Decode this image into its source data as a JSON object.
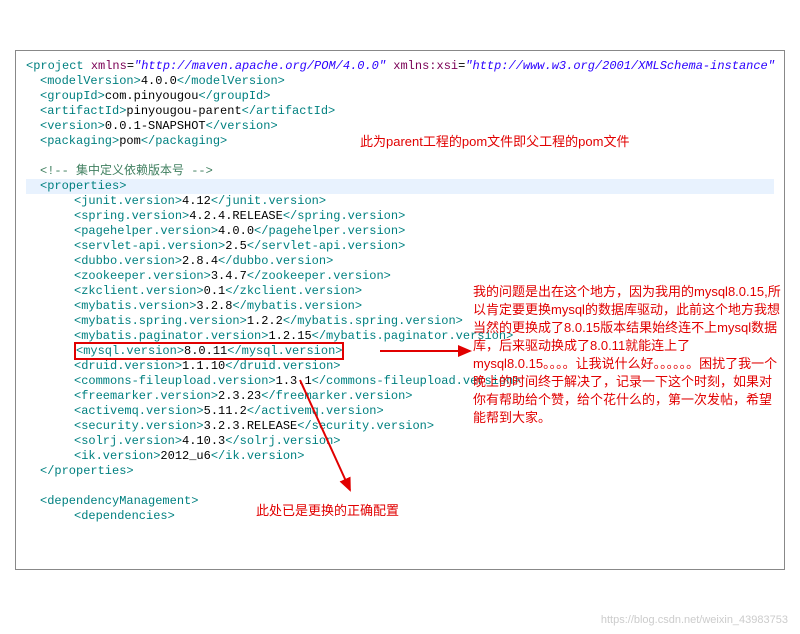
{
  "pom": {
    "project_open": "<project",
    "xmlns_attr": "xmlns",
    "xmlns_val": "\"http://maven.apache.org/POM/4.0.0\"",
    "xsi_attr": "xmlns:xsi",
    "xsi_val": "\"http://www.w3.org/2001/XMLSchema-instance\"",
    "modelVersion": "4.0.0",
    "groupId": "com.pinyougou",
    "artifactId": "pinyougou-parent",
    "version": "0.0.1-SNAPSHOT",
    "packaging": "pom",
    "comment_props": "<!-- 集中定义依赖版本号 -->",
    "props_open": "<properties>",
    "props_close": "</properties>",
    "deps_mgmt": "<dependencyManagement>",
    "deps_open": "<dependencies>",
    "props": [
      {
        "key": "junit.version",
        "val": "4.12"
      },
      {
        "key": "spring.version",
        "val": "4.2.4.RELEASE"
      },
      {
        "key": "pagehelper.version",
        "val": "4.0.0"
      },
      {
        "key": "servlet-api.version",
        "val": "2.5"
      },
      {
        "key": "dubbo.version",
        "val": "2.8.4"
      },
      {
        "key": "zookeeper.version",
        "val": "3.4.7"
      },
      {
        "key": "zkclient.version",
        "val": "0.1"
      },
      {
        "key": "mybatis.version",
        "val": "3.2.8"
      },
      {
        "key": "mybatis.spring.version",
        "val": "1.2.2"
      },
      {
        "key": "mybatis.paginator.version",
        "val": "1.2.15"
      },
      {
        "key": "mysql.version",
        "val": "8.0.11"
      },
      {
        "key": "druid.version",
        "val": "1.1.10"
      },
      {
        "key": "commons-fileupload.version",
        "val": "1.3.1"
      },
      {
        "key": "freemarker.version",
        "val": "2.3.23"
      },
      {
        "key": "activemq.version",
        "val": "5.11.2"
      },
      {
        "key": "security.version",
        "val": "3.2.3.RELEASE"
      },
      {
        "key": "solrj.version",
        "val": "4.10.3"
      },
      {
        "key": "ik.version",
        "val": "2012_u6"
      }
    ]
  },
  "annotations": {
    "top": "此为parent工程的pom文件即父工程的pom文件",
    "right": "我的问题是出在这个地方，因为我用的mysql8.0.15,所以肯定要更换mysql的数据库驱动，此前这个地方我想当然的更换成了8.0.15版本结果始终连不上mysql数据库，后来驱动换成了8.0.11就能连上了mysql8.0.15。。。。让我说什么好。。。。。。困扰了我一个晚上的时间终于解决了，记录一下这个时刻，如果对你有帮助给个赞，给个花什么的，第一次发帖，希望能帮到大家。",
    "bottom": "此处已是更换的正确配置"
  },
  "watermark": "https://blog.csdn.net/weixin_43983753"
}
